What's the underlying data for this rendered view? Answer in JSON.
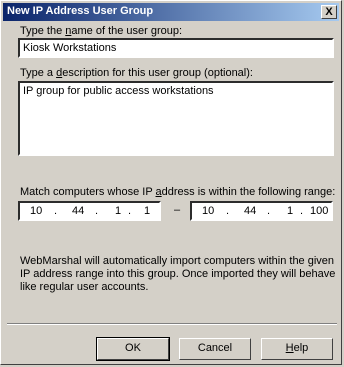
{
  "dialog": {
    "title": "New IP Address User Group",
    "close_glyph": "X"
  },
  "name_field": {
    "label_pre": "Type the ",
    "label_key": "n",
    "label_post": "ame of the user group:",
    "value": "Kiosk Workstations"
  },
  "description_field": {
    "label_pre": "Type a ",
    "label_key": "d",
    "label_post": "escription for this user group (optional):",
    "value": "IP group for public access workstations"
  },
  "range": {
    "label_pre": "Match computers whose IP ",
    "label_key": "a",
    "label_post": "ddress is within the following range:",
    "start": {
      "o1": "10",
      "o2": "44",
      "o3": "1",
      "o4": "1"
    },
    "end": {
      "o1": "10",
      "o2": "44",
      "o3": "1",
      "o4": "100"
    },
    "dot": ".",
    "separator": "–"
  },
  "info_text": "WebMarshal will automatically import computers within the given IP address range into this group. Once imported they will behave like regular user accounts.",
  "buttons": {
    "ok": "OK",
    "cancel": "Cancel",
    "help_key": "H",
    "help_rest": "elp"
  }
}
